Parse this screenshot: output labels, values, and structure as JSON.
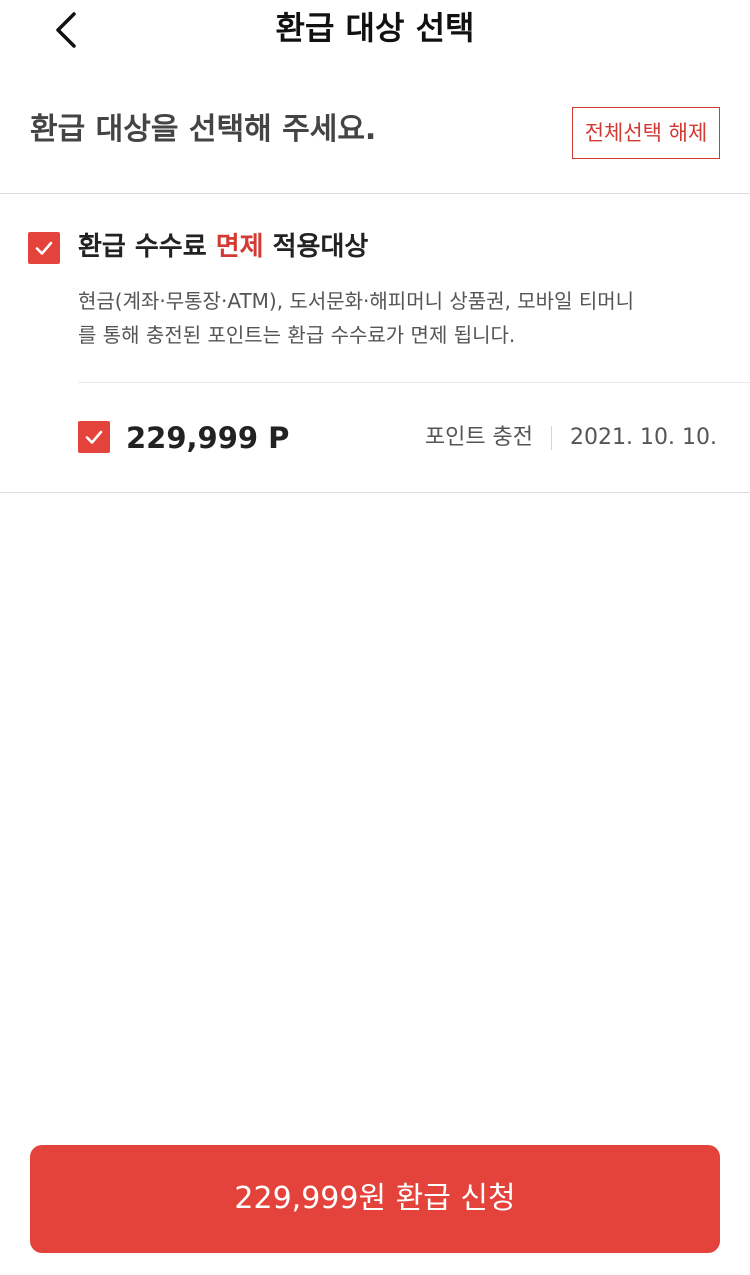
{
  "header": {
    "title": "환급 대상 선택",
    "back_icon": "chevron-left-icon"
  },
  "section": {
    "title": "환급 대상을 선택해 주세요.",
    "deselect_all_label": "전체선택 해제"
  },
  "group": {
    "checked": true,
    "title_part1": "환급 수수료 ",
    "title_accent": "면제",
    "title_part2": " 적용대상",
    "description_line1": "현금(계좌·무통장·ATM), 도서문화·해피머니 상품권, 모바일 티머니",
    "description_line2": "를 통해 충전된 포인트는 환급 수수료가 면제 됩니다."
  },
  "items": [
    {
      "checked": true,
      "amount": "229,999 P",
      "type": "포인트 충전",
      "date": "2021. 10. 10."
    }
  ],
  "footer": {
    "submit_label": "229,999원 환급 신청"
  },
  "colors": {
    "accent": "#e4433b",
    "accent_text": "#d33a34",
    "divider": "#dddddd"
  }
}
